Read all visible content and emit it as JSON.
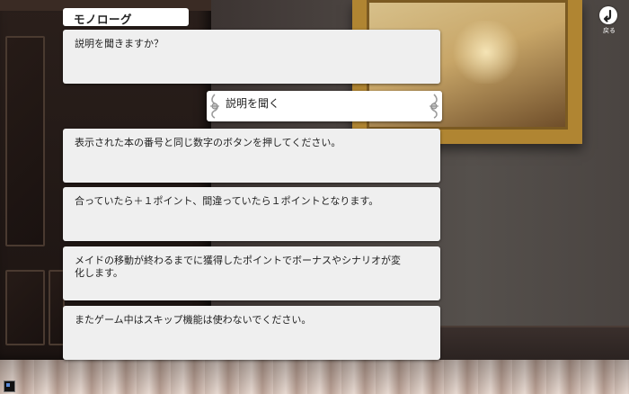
{
  "monologue": {
    "label": "モノローグ"
  },
  "question_box": {
    "text": "説明を聞きますか？"
  },
  "choice": {
    "label": "説明を聞く"
  },
  "instructions": [
    {
      "text": "表示された本の番号と同じ数字のボタンを押してください。"
    },
    {
      "text": "合っていたら＋１ポイント、間違っていたら１ポイントとなります。"
    },
    {
      "text": "メイドの移動が終わるまでに獲得したポイントでボーナスやシナリオが変化します。"
    },
    {
      "text": "またゲーム中はスキップ機能は使わないでください。"
    }
  ],
  "back_button": {
    "label": "戻る",
    "icon": "return-arrow-icon"
  },
  "colors": {
    "box_bg": "#efefef",
    "choice_bg": "#ffffff",
    "frame_gold": "#b08532",
    "text": "#222222"
  }
}
